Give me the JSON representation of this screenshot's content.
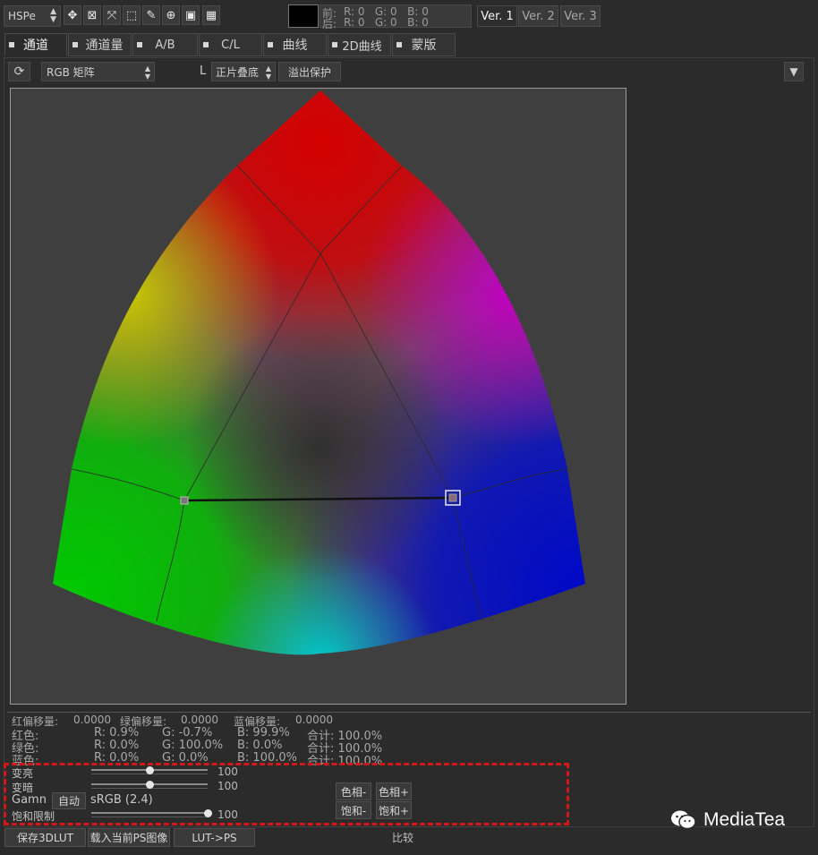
{
  "toolbar": {
    "mode_select": "HSPe",
    "tools": [
      {
        "name": "move-tool-icon",
        "glyph": "✥"
      },
      {
        "name": "grid-tool-icon",
        "glyph": "⊠"
      },
      {
        "name": "scale-tool-icon",
        "glyph": "⤧"
      },
      {
        "name": "marquee-tool-icon",
        "glyph": "⬚"
      },
      {
        "name": "eyedropper-tool-icon",
        "glyph": "✎"
      },
      {
        "name": "zoom-tool-icon",
        "glyph": "⊕"
      },
      {
        "name": "fit-tool-icon",
        "glyph": "▣"
      },
      {
        "name": "lut-grid-tool-icon",
        "glyph": "▦"
      }
    ],
    "before_label": "前:",
    "after_label": "后:",
    "before_rgb": "R: 0   G: 0   B: 0",
    "after_rgb": "R: 0   G: 0   B: 0",
    "versions": [
      "Ver. 1",
      "Ver. 2",
      "Ver. 3"
    ]
  },
  "tabs": [
    "通道",
    "通道量",
    "A/B",
    "C/L",
    "曲线",
    "2D曲线",
    "蒙版"
  ],
  "controls": {
    "refresh_icon": "⟳",
    "matrix_select": "RGB 矩阵",
    "l_label": "L",
    "blend_select": "正片叠底",
    "overflow_button": "溢出保护",
    "collapse_icon": "▼"
  },
  "offsets": {
    "red_label": "红偏移量:",
    "red_value": "0.0000",
    "green_label": "绿偏移量:",
    "green_value": "0.0000",
    "blue_label": "蓝偏移量:",
    "blue_value": "0.0000"
  },
  "matrix": [
    {
      "label": "红色:",
      "r": "R: 0.9%",
      "g": "G: -0.7%",
      "b": "B: 99.9%",
      "sum": "合计: 100.0%"
    },
    {
      "label": "绿色:",
      "r": "R: 0.0%",
      "g": "G: 100.0%",
      "b": "B: 0.0%",
      "sum": "合计: 100.0%"
    },
    {
      "label": "蓝色:",
      "r": "R: 0.0%",
      "g": "G: 0.0%",
      "b": "B: 100.0%",
      "sum": "合计: 100.0%"
    }
  ],
  "sliders": {
    "brighten_label": "变亮",
    "brighten_value": "100",
    "brighten_level": 0.5,
    "darken_label": "变暗",
    "darken_value": "100",
    "darken_level": 0.5,
    "gamma_label": "Gamn",
    "auto_button": "自动",
    "gamma_value": "sRGB (2.4)",
    "sat_limit_label": "饱和限制",
    "sat_limit_value": "100",
    "sat_limit_level": 1.0
  },
  "adjust_buttons": {
    "hue_minus": "色相-",
    "hue_plus": "色相+",
    "sat_minus": "饱和-",
    "sat_plus": "饱和+"
  },
  "bottom": {
    "save_3dlut": "保存3DLUT",
    "load_ps": "载入当前PS图像",
    "lut_to_ps": "LUT->PS",
    "compare": "比较"
  },
  "watermark": "MediaTea",
  "colors": {
    "red": "#d40000",
    "green": "#00c800",
    "blue": "#0008c8",
    "highlight": "#d01818"
  }
}
